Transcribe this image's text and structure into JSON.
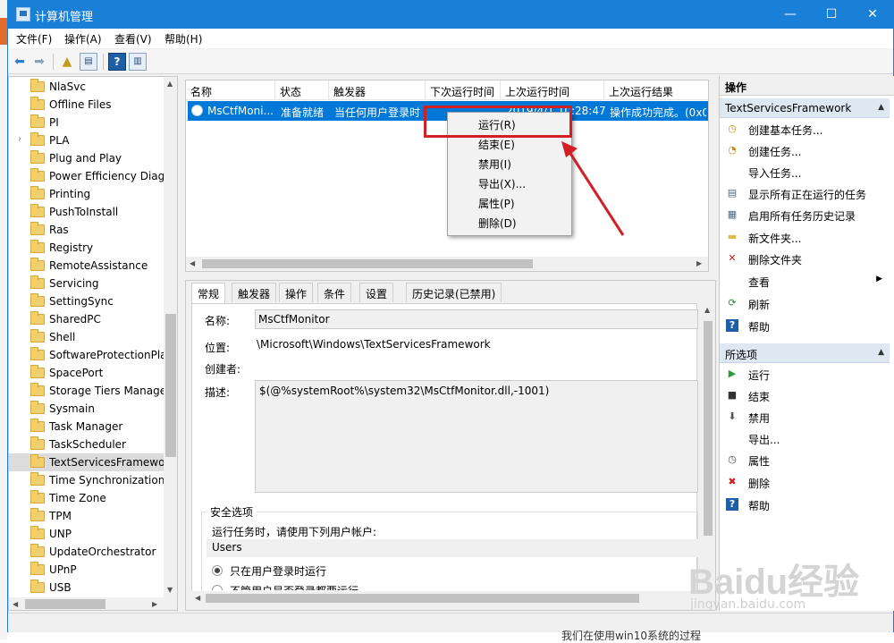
{
  "window": {
    "title": "计算机管理",
    "controls": {
      "minimize": "—",
      "maximize": "☐",
      "close": "✕"
    }
  },
  "menubar": [
    "文件(F)",
    "操作(A)",
    "查看(V)",
    "帮助(H)"
  ],
  "toolbar": {
    "help_glyph": "?"
  },
  "tree": {
    "items": [
      "NlaSvc",
      "Offline Files",
      "PI",
      "PLA",
      "Plug and Play",
      "Power Efficiency Diag",
      "Printing",
      "PushToInstall",
      "Ras",
      "Registry",
      "RemoteAssistance",
      "Servicing",
      "SettingSync",
      "SharedPC",
      "Shell",
      "SoftwareProtectionPla",
      "SpacePort",
      "Storage Tiers Manage",
      "Sysmain",
      "Task Manager",
      "TaskScheduler",
      "TextServicesFramewo",
      "Time Synchronization",
      "Time Zone",
      "TPM",
      "UNP",
      "UpdateOrchestrator",
      "UPnP",
      "USB"
    ],
    "selected_index": 21,
    "expandable_index": 3,
    "expand_glyph": "›"
  },
  "tasklist": {
    "columns": [
      "名称",
      "状态",
      "触发器",
      "下次运行时间",
      "上次运行时间",
      "上次运行结果"
    ],
    "row": {
      "name": "MsCtfMoni...",
      "status": "准备就绪",
      "trigger": "当任何用户登录时",
      "next_run": "",
      "last_run": "2019/4/1 10:28:47",
      "last_result": "操作成功完成。(0x0"
    }
  },
  "context_menu": {
    "items": [
      "运行(R)",
      "结束(E)",
      "禁用(I)",
      "导出(X)...",
      "属性(P)",
      "删除(D)"
    ],
    "highlighted": "运行(R)"
  },
  "details": {
    "tabs": [
      "常规",
      "触发器",
      "操作",
      "条件",
      "设置",
      "历史记录(已禁用)"
    ],
    "active_tab": "常规",
    "name_label": "名称:",
    "name_value": "MsCtfMonitor",
    "location_label": "位置:",
    "location_value": "\\Microsoft\\Windows\\TextServicesFramework",
    "author_label": "创建者:",
    "desc_label": "描述:",
    "desc_value": "$(@%systemRoot%\\system32\\MsCtfMonitor.dll,-1001)",
    "security_title": "安全选项",
    "run_as_label": "运行任务时，请使用下列用户帐户:",
    "run_as_value": "Users",
    "radio_1": "只在用户登录时运行",
    "radio_2": "不管用户是否登录都要运行"
  },
  "actions": {
    "header": "操作",
    "section1": {
      "title": "TextServicesFramework",
      "items": [
        "创建基本任务...",
        "创建任务...",
        "导入任务...",
        "显示所有正在运行的任务",
        "启用所有任务历史记录",
        "新文件夹...",
        "删除文件夹",
        "查看",
        "刷新",
        "帮助"
      ]
    },
    "section2": {
      "title": "所选项",
      "items": [
        "运行",
        "结束",
        "禁用",
        "导出...",
        "属性",
        "删除",
        "帮助"
      ]
    }
  },
  "watermark": {
    "brand": "Baidu经验",
    "url": "jingyan.baidu.com"
  },
  "bottom_text": "我们在使用win10系统的过程"
}
